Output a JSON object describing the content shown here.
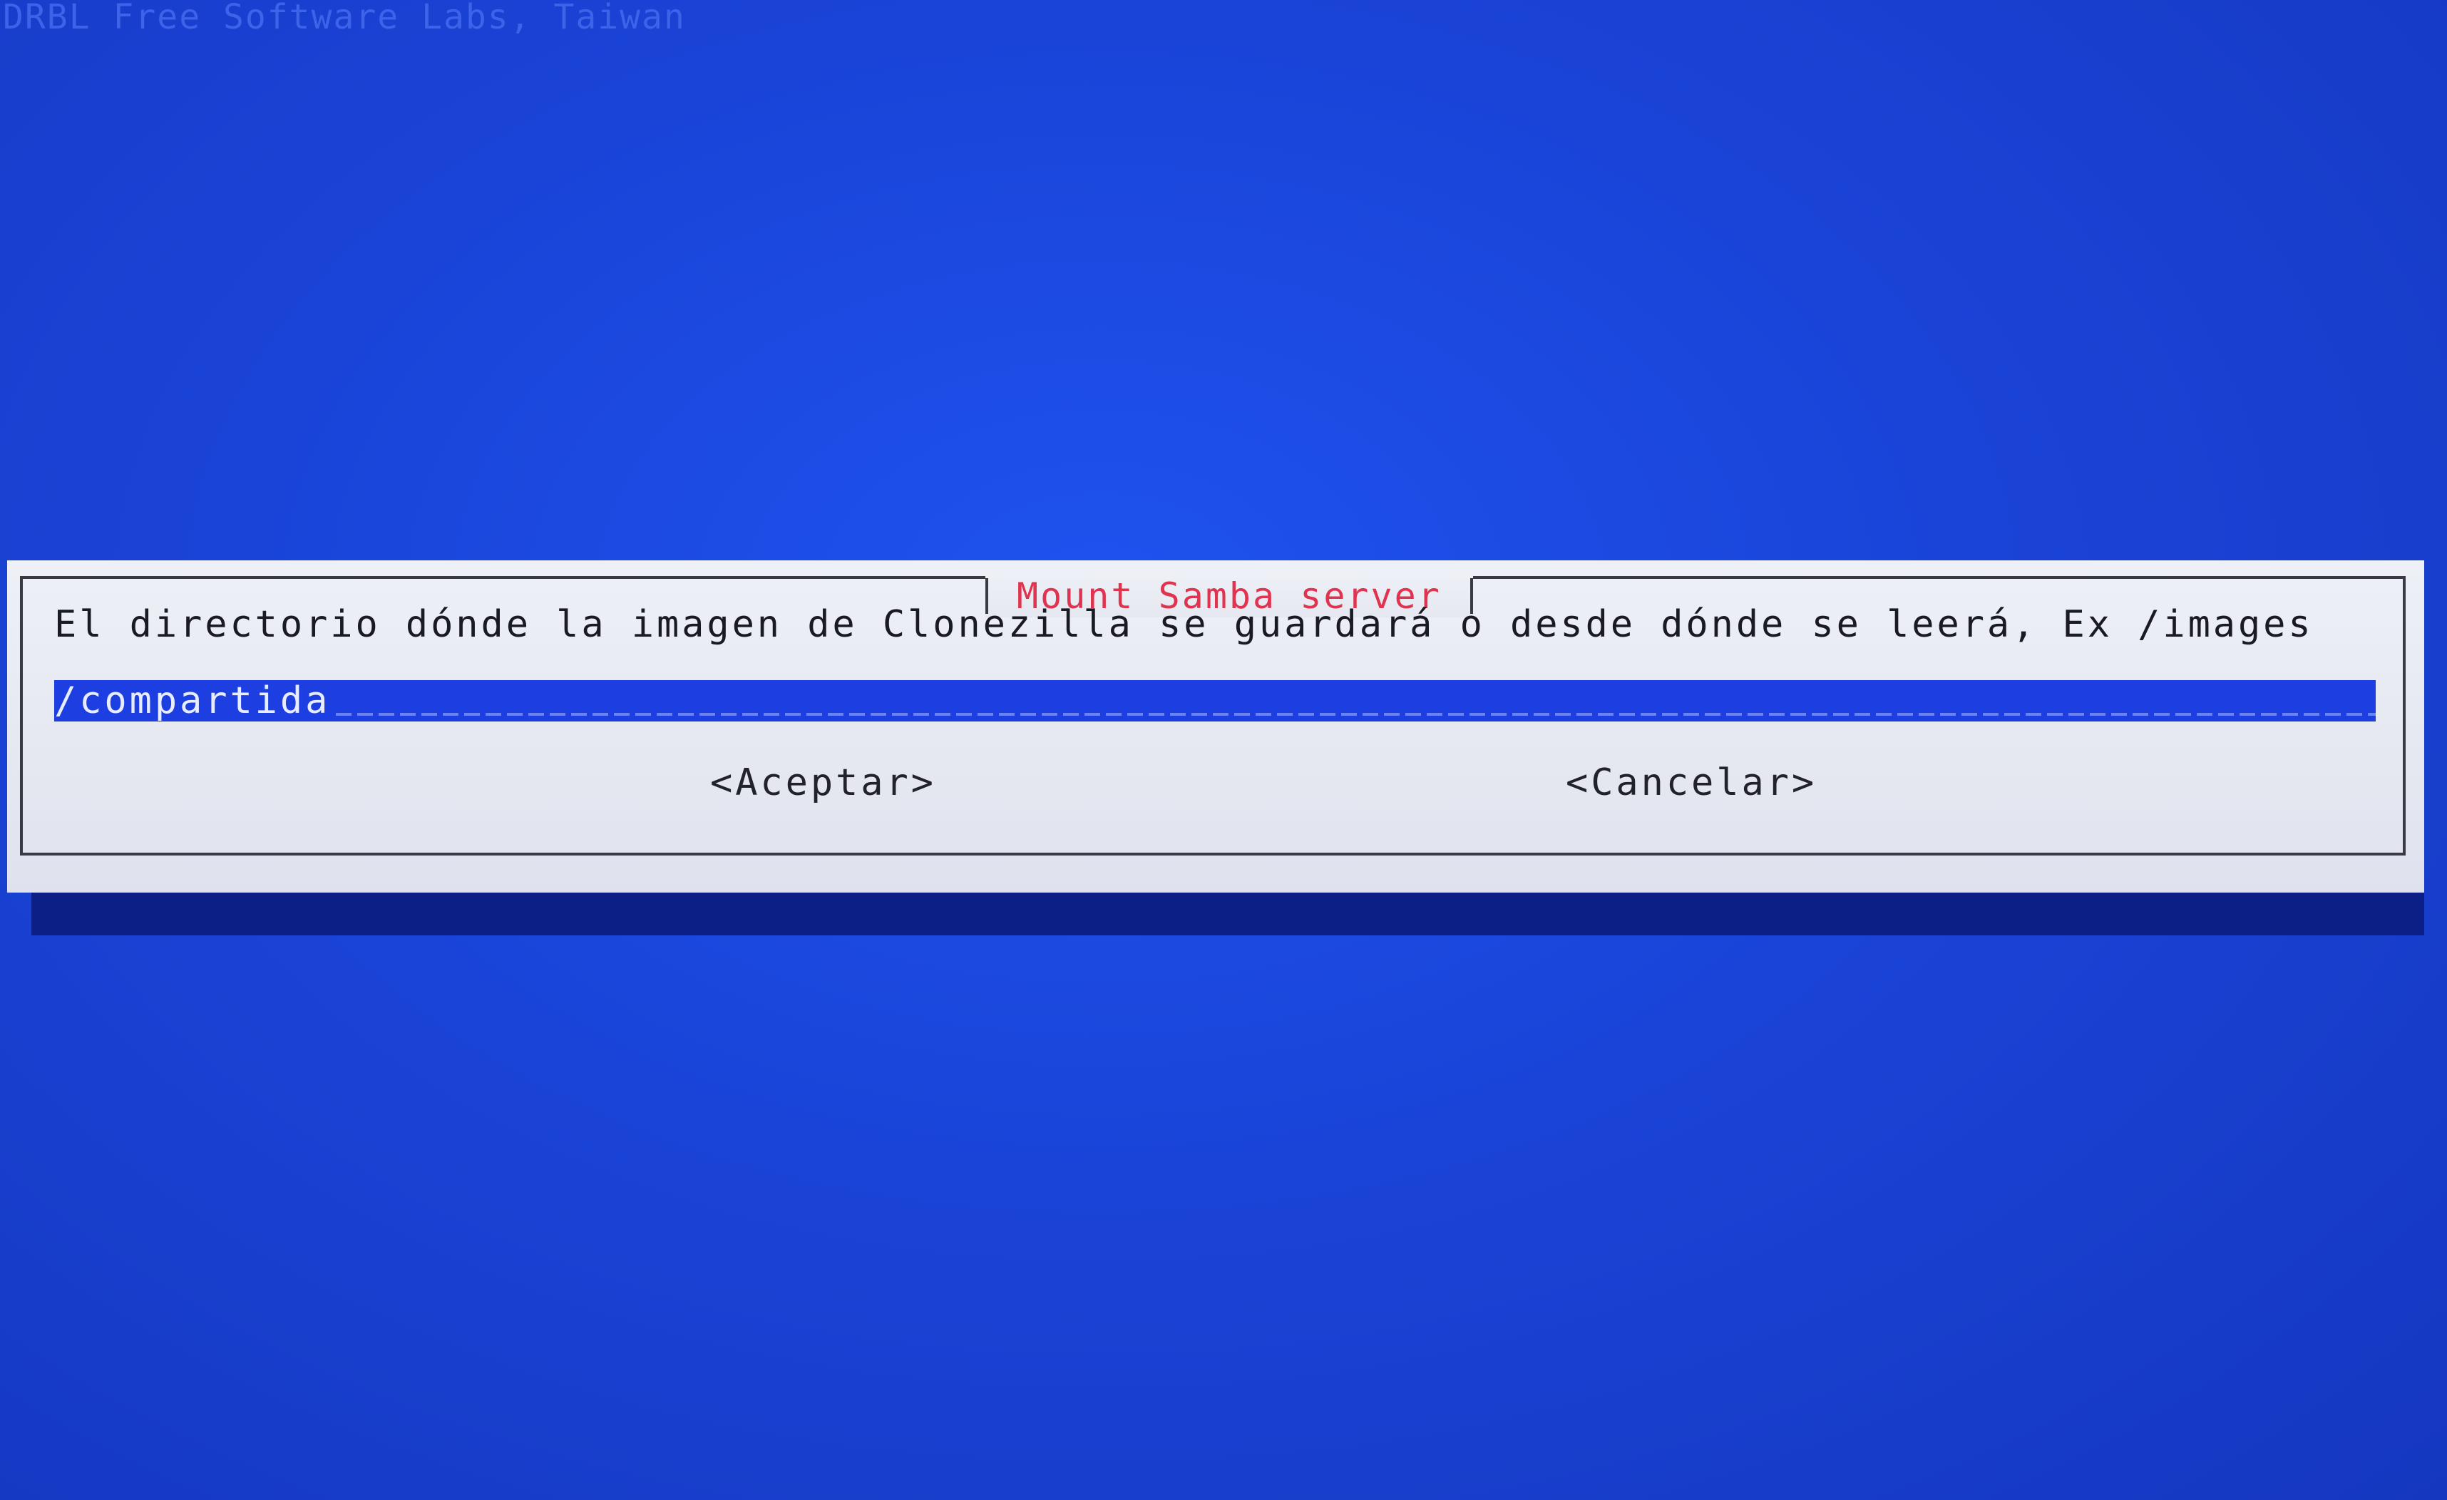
{
  "screen": {
    "backtitle": "DRBL Free Software Labs, Taiwan"
  },
  "dialog": {
    "title": "Mount Samba server",
    "message": "El directorio dónde la imagen de Clonezilla se guardará o desde dónde se leerá, Ex /images",
    "input": {
      "value": "/compartida"
    },
    "buttons": {
      "ok_label": "<Aceptar>",
      "cancel_label": "<Cancelar>"
    }
  },
  "colors": {
    "background": "#1a44d8",
    "dialog_bg": "#e6e8f1",
    "title_text": "#e0334f",
    "input_bg": "#1d3fe2",
    "input_text": "#e8ecff",
    "shadow": "#0b1f86"
  }
}
